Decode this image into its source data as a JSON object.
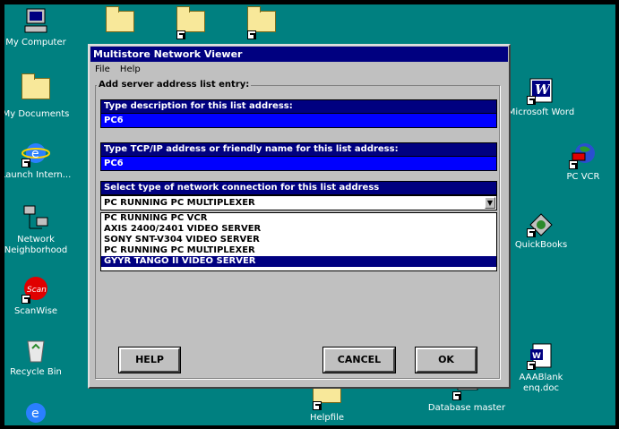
{
  "desktop": {
    "icons": {
      "my_computer": "My Computer",
      "my_documents": "My Documents",
      "launch_internet": "Launch Intern...",
      "network_neighborhood": "Network Neighborhood",
      "scanwise": "ScanWise",
      "recycle_bin": "Recycle Bin",
      "microsoft_word": "Microsoft Word",
      "pc_vcr": "PC VCR",
      "quickbooks": "QuickBooks",
      "aaablank": "AAABlank enq.doc",
      "helpfile": "Helpfile",
      "database_master": "Database master"
    },
    "colors": {
      "background": "#008080",
      "title_bar": "#000080",
      "field_value": "#0000ff"
    }
  },
  "window": {
    "title": "Multistore Network Viewer",
    "menu": {
      "file": "File",
      "help": "Help"
    },
    "group_label": "Add server address list entry:",
    "description": {
      "label": "Type description for this list address:",
      "value": "PC6"
    },
    "address": {
      "label": "Type TCP/IP address or friendly name for this list address:",
      "value": "PC6"
    },
    "connection": {
      "label": "Select type of network connection for this list address",
      "selected": "PC RUNNING PC MULTIPLEXER",
      "options": [
        "PC RUNNING PC VCR",
        "AXIS 2400/2401 VIDEO SERVER",
        "SONY SNT-V304 VIDEO SERVER",
        "PC RUNNING PC MULTIPLEXER",
        "GYYR TANGO II VIDEO SERVER"
      ],
      "highlighted_option": "GYYR TANGO II VIDEO SERVER"
    },
    "buttons": {
      "help": "HELP",
      "cancel": "CANCEL",
      "ok": "OK"
    }
  }
}
